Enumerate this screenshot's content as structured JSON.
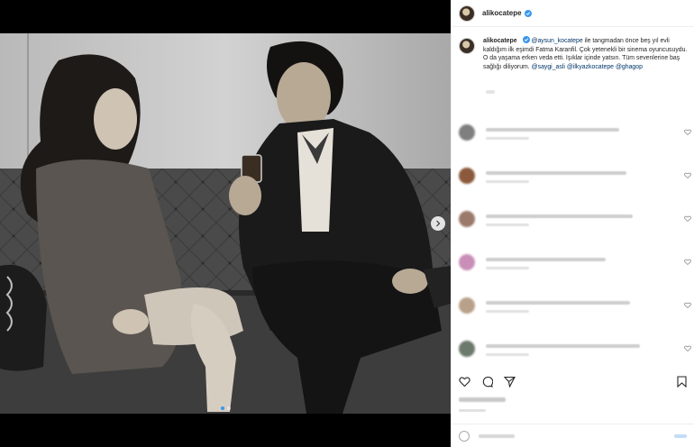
{
  "post": {
    "username": "alikocatepe",
    "verified": true,
    "caption": {
      "author": "alikocatepe",
      "mention_1": "@aysun_kocatepe",
      "line_1": " ile tangmadan önce beş yıl evli kaldığım ilk eşimdi Fatma Karanfil. Çok yetenekli bir sinema oyuncusuydu. O da yaşama erken veda etti. Işıklar içinde yatsın. Tüm sevenlerine baş sağlığı diliyorum. ",
      "mention_2": "@saygi_asli",
      "mention_3": "@ilkyazkocatepe",
      "mention_4": "@ghagop"
    },
    "carousel": {
      "count": 2,
      "active": 1
    }
  },
  "comments": [
    {
      "avatar_color": "#7f7f7f",
      "line_ratio": 0.78,
      "has_like": true
    },
    {
      "avatar_color": "#8b5a3c",
      "line_ratio": 0.82,
      "has_like": true
    },
    {
      "avatar_color": "#9a7a6a",
      "line_ratio": 0.86,
      "has_like": true
    },
    {
      "avatar_color": "#c98fb8",
      "line_ratio": 0.7,
      "has_like": true
    },
    {
      "avatar_color": "#b9a08a",
      "line_ratio": 0.84,
      "has_like": true
    },
    {
      "avatar_color": "#6c7a6c",
      "line_ratio": 0.9,
      "has_like": true
    }
  ],
  "icons": {
    "like": "heart-icon",
    "comment": "comment-icon",
    "share": "share-icon",
    "save": "bookmark-icon",
    "emoji": "emoji-icon",
    "next": "chevron-right-icon"
  },
  "colors": {
    "accent": "#3897f0",
    "mention": "#003569",
    "text": "#262626",
    "border": "#efefef"
  }
}
